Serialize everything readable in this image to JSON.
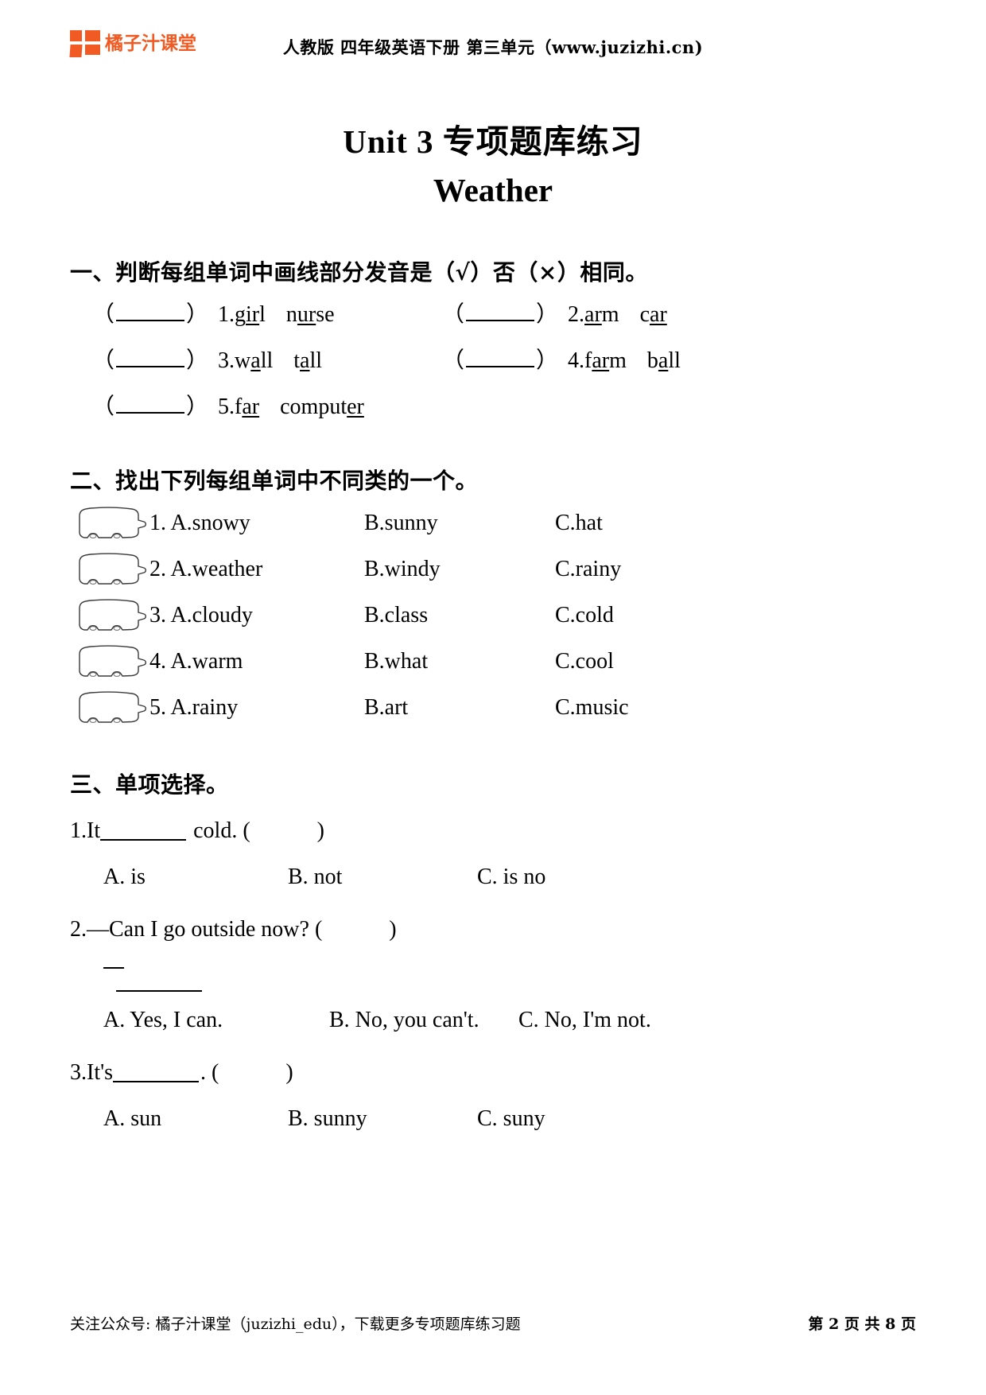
{
  "header": {
    "brand_name": "橘子汁课堂",
    "brand_color": "#F15A22",
    "title": "人教版 四年级英语下册 第三单元（www.juzizhi.cn)"
  },
  "title": "Unit 3  专项题库练习",
  "subtitle": "Weather",
  "sections": [
    {
      "heading": "一、判断每组单词中画线部分发音是（√）否（×）相同。",
      "items": [
        {
          "num": "1.",
          "w1_pre": "g",
          "w1_ul": "ir",
          "w1_post": "l",
          "w2_pre": "n",
          "w2_ul": "ur",
          "w2_post": "se"
        },
        {
          "num": "2.",
          "w1_pre": "",
          "w1_ul": "ar",
          "w1_post": "m",
          "w2_pre": "c",
          "w2_ul": "ar",
          "w2_post": ""
        },
        {
          "num": "3.",
          "w1_pre": "w",
          "w1_ul": "a",
          "w1_post": "ll",
          "w2_pre": "t",
          "w2_ul": "a",
          "w2_post": "ll"
        },
        {
          "num": "4.",
          "w1_pre": "f",
          "w1_ul": "ar",
          "w1_post": "m",
          "w2_pre": "b",
          "w2_ul": "a",
          "w2_post": "ll"
        },
        {
          "num": "5.",
          "w1_pre": "f",
          "w1_ul": "ar",
          "w1_post": "",
          "w2_pre": "comput",
          "w2_ul": "er",
          "w2_post": ""
        }
      ]
    },
    {
      "heading": "二、找出下列每组单词中不同类的一个。",
      "items": [
        {
          "label": "1. A.snowy",
          "b": "B.sunny",
          "c": "C.hat"
        },
        {
          "label": "2. A.weather",
          "b": "B.windy",
          "c": "C.rainy"
        },
        {
          "label": "3. A.cloudy",
          "b": "B.class",
          "c": "C.cold"
        },
        {
          "label": "4. A.warm",
          "b": "B.what",
          "c": "C.cool"
        },
        {
          "label": "5. A.rainy",
          "b": "B.art",
          "c": "C.music"
        }
      ]
    },
    {
      "heading": "三、单项选择。",
      "questions": [
        {
          "stem_pre": "1.It",
          "stem_post": "cold. (",
          "stem_close": ")",
          "a": "A. is",
          "b": "B. not",
          "c": "C. is no"
        },
        {
          "stem_pre": "2.—Can I go outside now? (",
          "stem_post": "",
          "stem_close": ")",
          "a": "A. Yes, I can.",
          "b": "B. No, you can't.",
          "c": "C. No, I'm not."
        },
        {
          "stem_pre": "3.It's",
          "stem_post": ". (",
          "stem_close": ")",
          "a": "A. sun",
          "b": "B. sunny",
          "c": "C. suny"
        }
      ]
    }
  ],
  "footer": {
    "left": "关注公众号: 橘子汁课堂（juzizhi_edu），下载更多专项题库练习题",
    "page_prefix": "第",
    "page_num": "2",
    "page_mid": "页 共",
    "page_total": "8",
    "page_suffix": "页"
  }
}
